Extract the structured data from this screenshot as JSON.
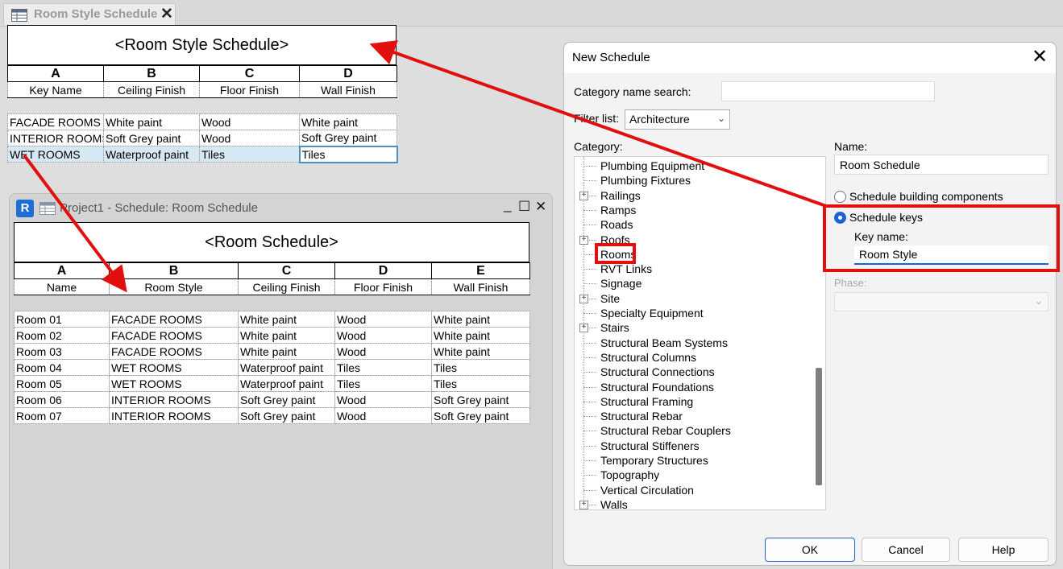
{
  "tab": {
    "title": "Room Style Schedule",
    "close": "✕"
  },
  "style_schedule": {
    "title": "<Room Style Schedule>",
    "letters": [
      "A",
      "B",
      "C",
      "D"
    ],
    "headers": [
      "Key Name",
      "Ceiling Finish",
      "Floor Finish",
      "Wall Finish"
    ],
    "rows": [
      [
        "FACADE ROOMS",
        "White paint",
        "Wood",
        "White paint"
      ],
      [
        "INTERIOR ROOMS",
        "Soft Grey paint",
        "Wood",
        "Soft Grey paint"
      ],
      [
        "WET ROOMS",
        "Waterproof paint",
        "Tiles",
        "Tiles"
      ]
    ]
  },
  "project_window": {
    "logo": "R",
    "title": "Project1 - Schedule: Room Schedule",
    "minimize": "_",
    "maximize": "☐",
    "close": "✕"
  },
  "room_schedule": {
    "title": "<Room Schedule>",
    "letters": [
      "A",
      "B",
      "C",
      "D",
      "E"
    ],
    "headers": [
      "Name",
      "Room Style",
      "Ceiling Finish",
      "Floor Finish",
      "Wall Finish"
    ],
    "rows": [
      [
        "Room 01",
        "FACADE ROOMS",
        "White paint",
        "Wood",
        "White paint"
      ],
      [
        "Room 02",
        "FACADE ROOMS",
        "White paint",
        "Wood",
        "White paint"
      ],
      [
        "Room 03",
        "FACADE ROOMS",
        "White paint",
        "Wood",
        "White paint"
      ],
      [
        "Room 04",
        "WET ROOMS",
        "Waterproof paint",
        "Tiles",
        "Tiles"
      ],
      [
        "Room 05",
        "WET ROOMS",
        "Waterproof paint",
        "Tiles",
        "Tiles"
      ],
      [
        "Room 06",
        "INTERIOR ROOMS",
        "Soft Grey paint",
        "Wood",
        "Soft Grey paint"
      ],
      [
        "Room 07",
        "INTERIOR ROOMS",
        "Soft Grey paint",
        "Wood",
        "Soft Grey paint"
      ]
    ]
  },
  "dialog": {
    "title": "New Schedule",
    "close": "✕",
    "category_search_label": "Category name search:",
    "category_search_value": "",
    "filter_label": "Filter list:",
    "filter_value": "Architecture",
    "category_label": "Category:",
    "categories": [
      {
        "label": "Plumbing Equipment",
        "expandable": false
      },
      {
        "label": "Plumbing Fixtures",
        "expandable": false
      },
      {
        "label": "Railings",
        "expandable": true
      },
      {
        "label": "Ramps",
        "expandable": false
      },
      {
        "label": "Roads",
        "expandable": false
      },
      {
        "label": "Roofs",
        "expandable": true
      },
      {
        "label": "Rooms",
        "expandable": false
      },
      {
        "label": "RVT Links",
        "expandable": false
      },
      {
        "label": "Signage",
        "expandable": false
      },
      {
        "label": "Site",
        "expandable": true
      },
      {
        "label": "Specialty Equipment",
        "expandable": false
      },
      {
        "label": "Stairs",
        "expandable": true
      },
      {
        "label": "Structural Beam Systems",
        "expandable": false
      },
      {
        "label": "Structural Columns",
        "expandable": false
      },
      {
        "label": "Structural Connections",
        "expandable": false
      },
      {
        "label": "Structural Foundations",
        "expandable": false
      },
      {
        "label": "Structural Framing",
        "expandable": false
      },
      {
        "label": "Structural Rebar",
        "expandable": false
      },
      {
        "label": "Structural Rebar Couplers",
        "expandable": false
      },
      {
        "label": "Structural Stiffeners",
        "expandable": false
      },
      {
        "label": "Temporary Structures",
        "expandable": false
      },
      {
        "label": "Topography",
        "expandable": false
      },
      {
        "label": "Vertical Circulation",
        "expandable": false
      },
      {
        "label": "Walls",
        "expandable": true
      }
    ],
    "selected_category": "Rooms",
    "name_label": "Name:",
    "name_value": "Room Schedule",
    "option_components": "Schedule building components",
    "option_keys": "Schedule keys",
    "selected_option": "Schedule keys",
    "key_name_label": "Key name:",
    "key_name_value": "Room Style",
    "phase_label": "Phase:",
    "ok": "OK",
    "cancel": "Cancel",
    "help": "Help"
  },
  "colors": {
    "annotation_red": "#e20f0f",
    "selection_blue": "#1e63d6",
    "selected_row": "#d7e8f5"
  },
  "icons": [
    "schedule-icon",
    "revit-logo-icon",
    "expand-icon",
    "chevron-down-icon",
    "radio-icon",
    "close-icon"
  ]
}
